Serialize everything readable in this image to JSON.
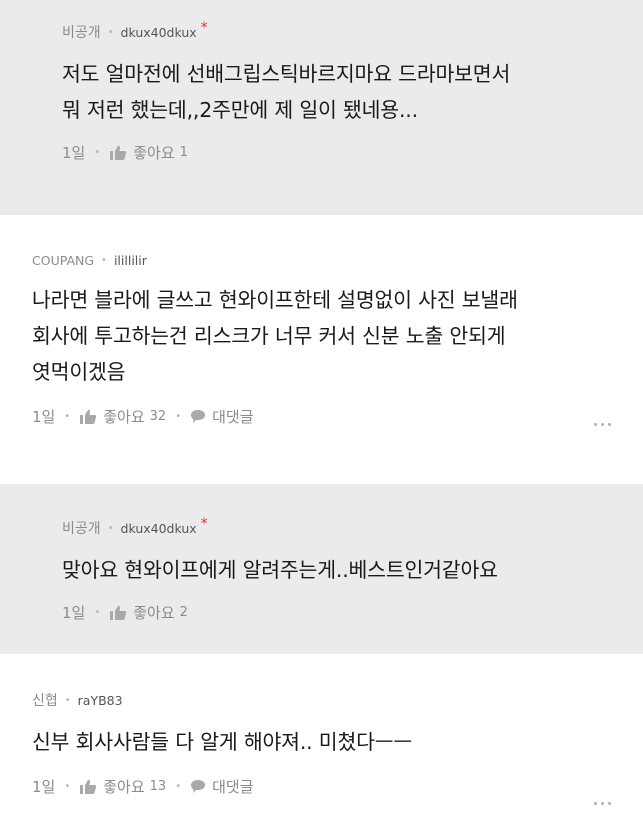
{
  "comments": [
    {
      "type": "reply",
      "company": "비공개",
      "nickname": "dkux40dkux",
      "author_mark": "*",
      "lines": [
        "저도 얼마전에 선배그립스틱바르지마요 드라마보면서",
        "뭐 저런 했는데,,2주만에 제 일이 됐네용..."
      ],
      "time": "1일",
      "like_label": "좋아요",
      "like_count": "1"
    },
    {
      "type": "comment",
      "company": "COUPANG",
      "nickname": "ilillilir",
      "lines": [
        "나라면 블라에 글쓰고 현와이프한테 설명없이 사진 보낼래",
        "회사에 투고하는건 리스크가 너무 커서 신분 노출 안되게",
        "엿먹이겠음"
      ],
      "time": "1일",
      "like_label": "좋아요",
      "like_count": "32",
      "reply_label": "대댓글"
    },
    {
      "type": "reply",
      "company": "비공개",
      "nickname": "dkux40dkux",
      "author_mark": "*",
      "lines": [
        "맞아요 현와이프에게 알려주는게..베스트인거같아요"
      ],
      "time": "1일",
      "like_label": "좋아요",
      "like_count": "2"
    },
    {
      "type": "comment",
      "company": "신협",
      "nickname": "raYB83",
      "lines": [
        "신부 회사사람들 다 알게 해야져.. 미쳤다ㅡㅡ"
      ],
      "time": "1일",
      "like_label": "좋아요",
      "like_count": "13",
      "reply_label": "대댓글"
    }
  ],
  "colors": {
    "reply_bg": "#ebebed",
    "meta": "#8c8c8c",
    "author_mark": "#e0322b"
  },
  "icons": {
    "like": "thumbs-up-icon",
    "reply": "speech-bubble-icon",
    "more": "more-dots-icon"
  }
}
